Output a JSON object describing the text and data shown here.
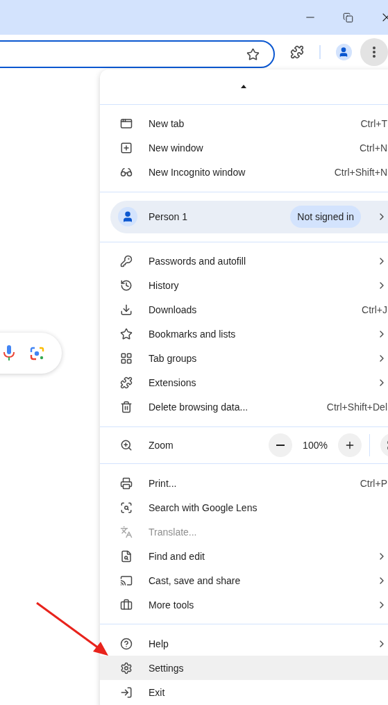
{
  "menu": {
    "sections": [
      {
        "kind": "items",
        "items": [
          {
            "label": "New tab",
            "shortcut": "Ctrl+T",
            "submenu": false,
            "disabled": false,
            "hovered": false
          },
          {
            "label": "New window",
            "shortcut": "Ctrl+N",
            "submenu": false,
            "disabled": false,
            "hovered": false
          },
          {
            "label": "New Incognito window",
            "shortcut": "Ctrl+Shift+N",
            "submenu": false,
            "disabled": false,
            "hovered": false
          }
        ]
      },
      {
        "kind": "profile",
        "name": "Person 1",
        "status": "Not signed in",
        "submenu": true
      },
      {
        "kind": "items",
        "items": [
          {
            "label": "Passwords and autofill",
            "submenu": true,
            "disabled": false,
            "hovered": false
          },
          {
            "label": "History",
            "submenu": true,
            "disabled": false,
            "hovered": false
          },
          {
            "label": "Downloads",
            "shortcut": "Ctrl+J",
            "submenu": false,
            "disabled": false,
            "hovered": false
          },
          {
            "label": "Bookmarks and lists",
            "submenu": true,
            "disabled": false,
            "hovered": false
          },
          {
            "label": "Tab groups",
            "submenu": true,
            "disabled": false,
            "hovered": false
          },
          {
            "label": "Extensions",
            "submenu": true,
            "disabled": false,
            "hovered": false
          },
          {
            "label": "Delete browsing data...",
            "shortcut": "Ctrl+Shift+Del",
            "submenu": false,
            "disabled": false,
            "hovered": false
          }
        ]
      },
      {
        "kind": "zoom",
        "label": "Zoom",
        "value": "100%"
      },
      {
        "kind": "items",
        "items": [
          {
            "label": "Print...",
            "shortcut": "Ctrl+P",
            "submenu": false,
            "disabled": false,
            "hovered": false
          },
          {
            "label": "Search with Google Lens",
            "submenu": false,
            "disabled": false,
            "hovered": false
          },
          {
            "label": "Translate...",
            "submenu": false,
            "disabled": true,
            "hovered": false
          },
          {
            "label": "Find and edit",
            "submenu": true,
            "disabled": false,
            "hovered": false
          },
          {
            "label": "Cast, save and share",
            "submenu": true,
            "disabled": false,
            "hovered": false
          },
          {
            "label": "More tools",
            "submenu": true,
            "disabled": false,
            "hovered": false
          }
        ]
      },
      {
        "kind": "items",
        "items": [
          {
            "label": "Help",
            "submenu": true,
            "disabled": false,
            "hovered": false
          },
          {
            "label": "Settings",
            "submenu": false,
            "disabled": false,
            "hovered": true
          },
          {
            "label": "Exit",
            "submenu": false,
            "disabled": false,
            "hovered": false
          }
        ]
      }
    ]
  }
}
